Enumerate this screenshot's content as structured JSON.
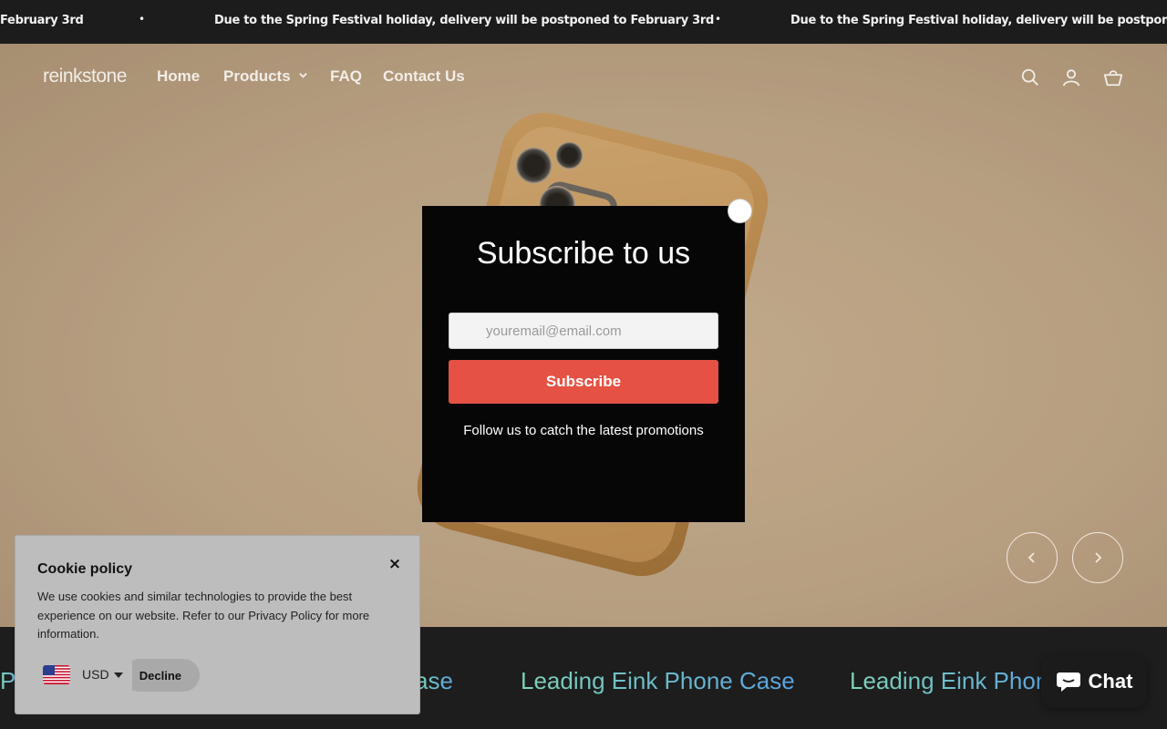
{
  "announcement": {
    "message": "Due to the Spring Festival holiday, delivery will be postponed to February 3rd",
    "partial_left": "February 3rd",
    "partial_right": "Due to the Spring Festival holiday, delivery will be postponed to Feb",
    "separator": "•"
  },
  "header": {
    "logo": "reinkstone",
    "nav": {
      "home": "Home",
      "products": "Products",
      "faq": "FAQ",
      "contact": "Contact Us"
    },
    "icons": [
      "search-icon",
      "account-icon",
      "cart-icon"
    ]
  },
  "hero": {
    "prev_icon": "chevron-left-icon",
    "next_icon": "chevron-right-icon"
  },
  "band": {
    "text": "Leading Eink Phone Case",
    "partial_1": "Pl",
    "partial_2": "ase",
    "partial_3": "Leading Eink Phone"
  },
  "subscribe_modal": {
    "title": "Subscribe to us",
    "email_placeholder": "youremail@email.com",
    "button": "Subscribe",
    "note": "Follow us to catch the latest promotions"
  },
  "cookie_banner": {
    "title": "Cookie policy",
    "text": "We use cookies and similar technologies to provide the best experience on our website. Refer to our Privacy Policy for more information.",
    "decline": "Decline",
    "close": "×"
  },
  "currency": {
    "code": "USD"
  },
  "chat": {
    "label": "Chat"
  },
  "colors": {
    "accent_red": "#e55244",
    "announcement_bg": "#1c1c1c",
    "modal_bg": "#060606",
    "band_gradient_start": "#7fd3b6",
    "band_gradient_end": "#5aa3e0"
  }
}
